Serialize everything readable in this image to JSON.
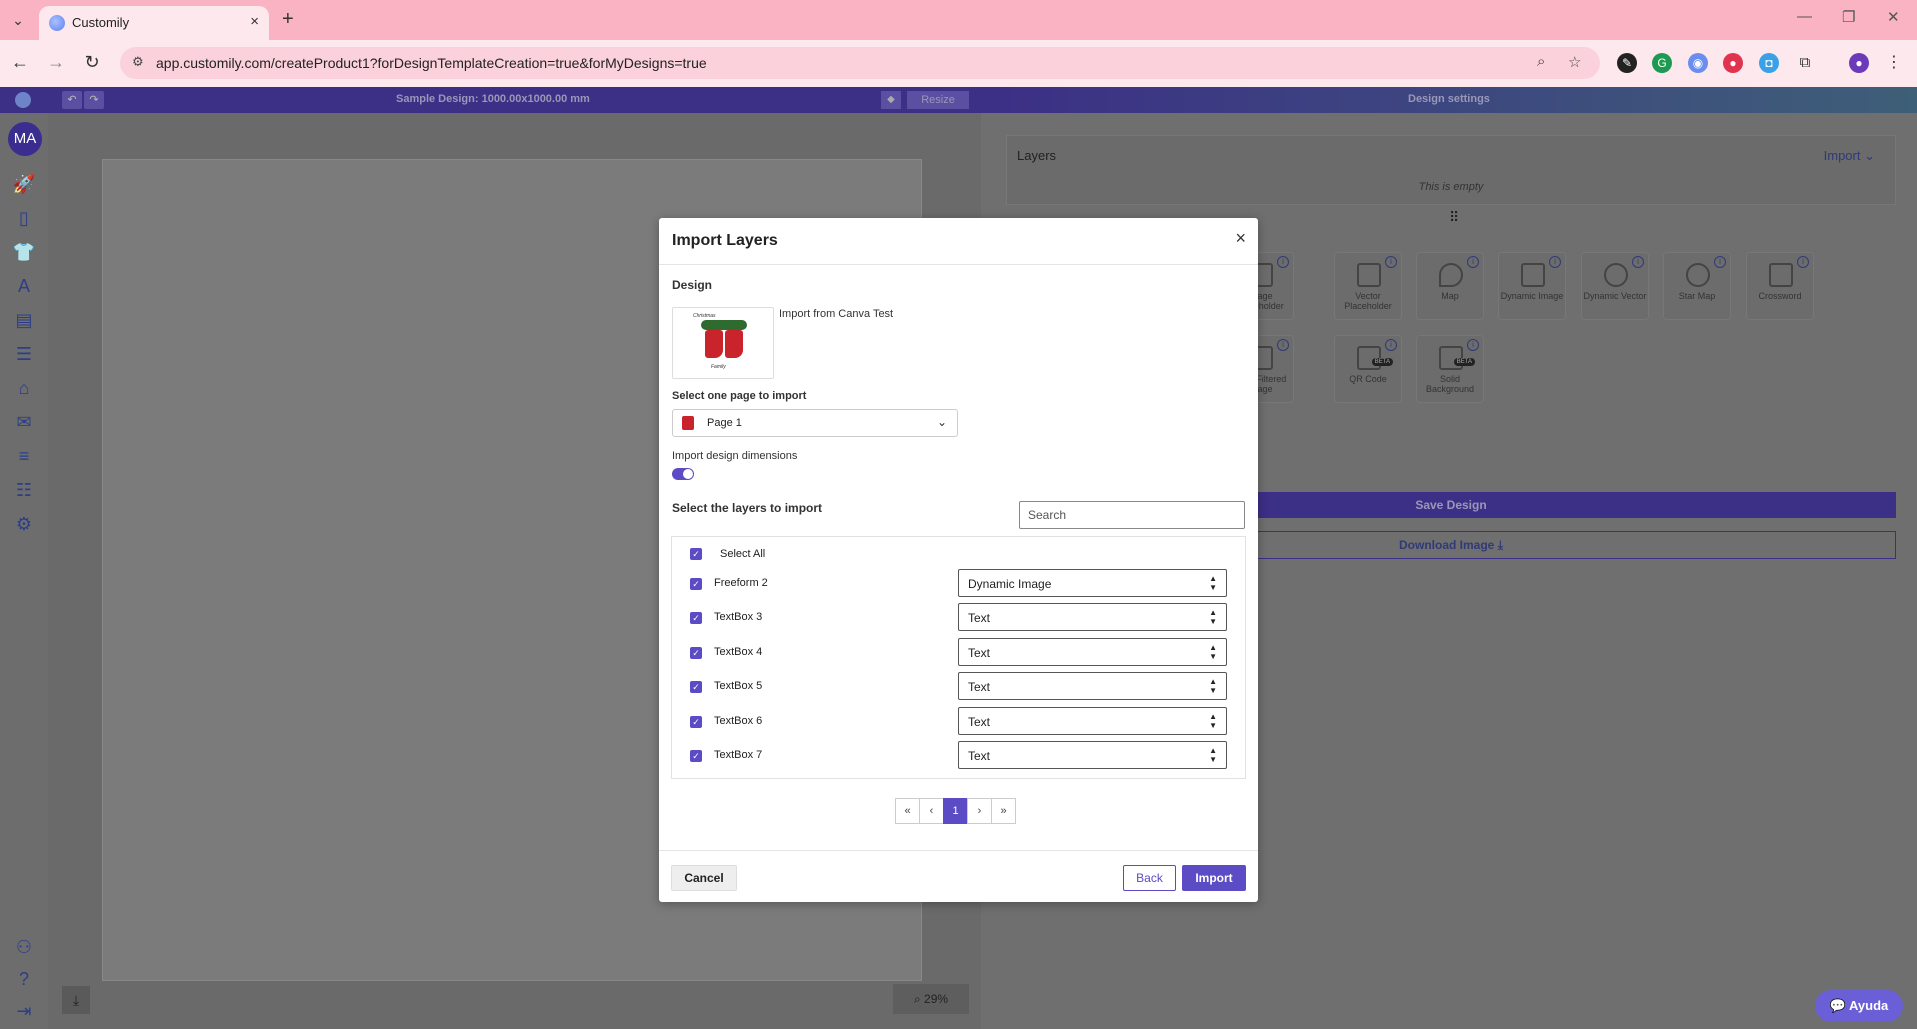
{
  "browser": {
    "tab_title": "Customily",
    "url": "app.customily.com/createProduct1?forDesignTemplateCreation=true&forMyDesigns=true"
  },
  "rail": {
    "avatar_initials": "MA"
  },
  "editor": {
    "design_title": "Sample Design: 1000.00x1000.00 mm",
    "resize_label": "Resize",
    "zoom_level": "29%"
  },
  "settings": {
    "title": "Design settings",
    "layers_title": "Layers",
    "import_label": "Import",
    "empty_text": "This is empty",
    "tools": [
      {
        "label": "Image Placeholder",
        "icon": "image-icon"
      },
      {
        "label": "Vector Placeholder",
        "icon": "vector-icon"
      },
      {
        "label": "Map",
        "icon": "map-pin-icon"
      },
      {
        "label": "Dynamic Image",
        "icon": "dynamic-image-icon"
      },
      {
        "label": "Dynamic Vector",
        "icon": "shapes-icon"
      },
      {
        "label": "Star Map",
        "icon": "star-map-icon"
      },
      {
        "label": "Crossword",
        "icon": "crossword-icon"
      },
      {
        "label": "Meta Filtered Image",
        "icon": "filtered-image-icon"
      },
      {
        "label": "QR Code",
        "icon": "qr-code-icon"
      },
      {
        "label": "Solid Background",
        "icon": "solid-background-icon"
      }
    ],
    "beta_label": "BETA",
    "save_label": "Save Design",
    "download_label": "Download Image"
  },
  "modal": {
    "title": "Import Layers",
    "design_label": "Design",
    "design_name": "Import from Canva Test",
    "select_page_label": "Select one page to import",
    "selected_page": "Page 1",
    "dimensions_label": "Import design dimensions",
    "dimensions_enabled": true,
    "select_layers_label": "Select the layers to import",
    "search_placeholder": "Search",
    "select_all_label": "Select All",
    "layers": [
      {
        "name": "Freeform 2",
        "type": "Dynamic Image",
        "checked": true
      },
      {
        "name": "TextBox 3",
        "type": "Text",
        "checked": true
      },
      {
        "name": "TextBox 4",
        "type": "Text",
        "checked": true
      },
      {
        "name": "TextBox 5",
        "type": "Text",
        "checked": true
      },
      {
        "name": "TextBox 6",
        "type": "Text",
        "checked": true
      },
      {
        "name": "TextBox 7",
        "type": "Text",
        "checked": true
      }
    ],
    "pager": {
      "first": "«",
      "prev": "‹",
      "current": "1",
      "next": "›",
      "last": "»"
    },
    "cancel_label": "Cancel",
    "back_label": "Back",
    "import_label": "Import"
  },
  "help": {
    "label": "Ayuda"
  },
  "colors": {
    "accent": "#5b4bc4",
    "header_dark": "#3c2f86",
    "chrome_tab": "#f9b3c3"
  }
}
